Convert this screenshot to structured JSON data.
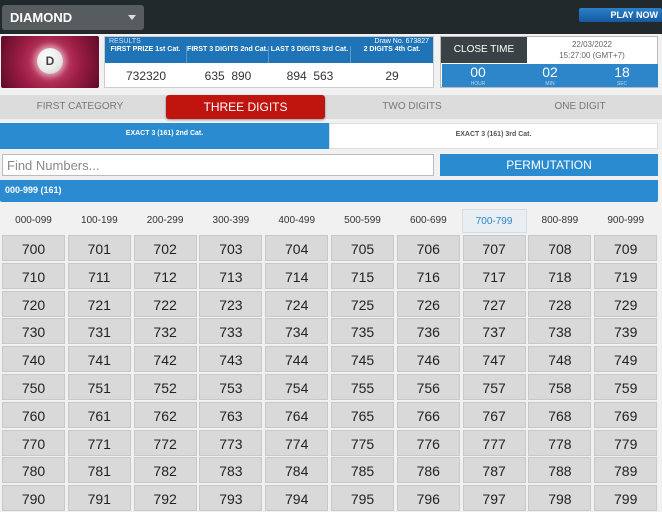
{
  "game_select": {
    "value": "DIAMOND"
  },
  "play_now": "PLAY NOW",
  "logo": {
    "letter": "D"
  },
  "results": {
    "label": "RESULTS",
    "draw_no": "Draw No. 673827",
    "columns": [
      {
        "header": "FIRST PRIZE 1st Cat.",
        "value": "732320"
      },
      {
        "header": "FIRST 3 DIGITS 2nd Cat.",
        "value": "635  890"
      },
      {
        "header": "LAST 3 DIGITS 3rd Cat.",
        "value": "894  563"
      },
      {
        "header": "2 DIGITS 4th Cat.",
        "value": "29"
      }
    ]
  },
  "close_time": {
    "label": "CLOSE TIME",
    "date": "22/03/2022",
    "time": "15:27:00 (GMT+7)",
    "countdown": [
      {
        "value": "00",
        "unit": "HOUR"
      },
      {
        "value": "02",
        "unit": "MIN"
      },
      {
        "value": "18",
        "unit": "SEC"
      }
    ]
  },
  "categories": [
    "FIRST CATEGORY",
    "THREE DIGITS",
    "TWO DIGITS",
    "ONE DIGIT"
  ],
  "subtabs": [
    "EXACT 3 (161) 2nd Cat.",
    "EXACT 3 (161) 3rd Cat."
  ],
  "search": {
    "placeholder": "Find Numbers..."
  },
  "permutation_label": "PERMUTATION",
  "range_title": "000-999 (161)",
  "ranges": [
    "000-099",
    "100-199",
    "200-299",
    "300-399",
    "400-499",
    "500-599",
    "600-699",
    "700-799",
    "800-899",
    "900-999"
  ],
  "active_range": "700-799",
  "numbers": [
    "700",
    "701",
    "702",
    "703",
    "704",
    "705",
    "706",
    "707",
    "708",
    "709",
    "710",
    "711",
    "712",
    "713",
    "714",
    "715",
    "716",
    "717",
    "718",
    "719",
    "720",
    "721",
    "722",
    "723",
    "724",
    "725",
    "726",
    "727",
    "728",
    "729",
    "730",
    "731",
    "732",
    "733",
    "734",
    "735",
    "736",
    "737",
    "738",
    "739",
    "740",
    "741",
    "742",
    "743",
    "744",
    "745",
    "746",
    "747",
    "748",
    "749",
    "750",
    "751",
    "752",
    "753",
    "754",
    "755",
    "756",
    "757",
    "758",
    "759",
    "760",
    "761",
    "762",
    "763",
    "764",
    "765",
    "766",
    "767",
    "768",
    "769",
    "770",
    "771",
    "772",
    "773",
    "774",
    "775",
    "776",
    "777",
    "778",
    "779",
    "780",
    "781",
    "782",
    "783",
    "784",
    "785",
    "786",
    "787",
    "788",
    "789",
    "790",
    "791",
    "792",
    "793",
    "794",
    "795",
    "796",
    "797",
    "798",
    "799"
  ]
}
